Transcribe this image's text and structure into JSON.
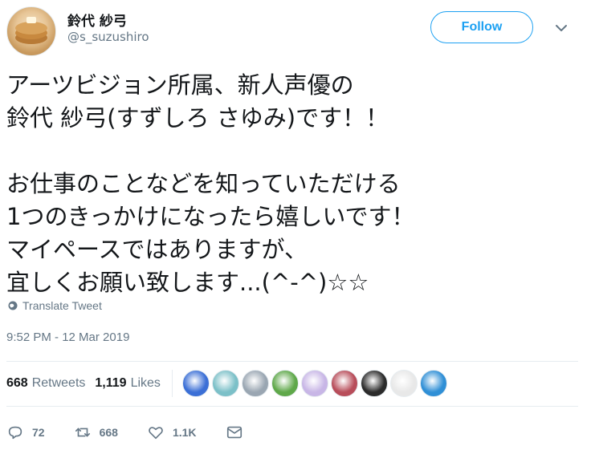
{
  "user": {
    "display_name": "鈴代 紗弓",
    "handle": "@s_suzushiro",
    "follow_label": "Follow"
  },
  "tweet": {
    "text": "アーツビジョン所属、新人声優の\n鈴代 紗弓(すずしろ さゆみ)です！！\n\nお仕事のことなどを知っていただける\n1つのきっかけになったら嬉しいです！\nマイペースではありますが、\n宜しくお願い致します...(^-^)☆☆",
    "translate_label": "Translate Tweet",
    "timestamp": "9:52 PM - 12 Mar 2019"
  },
  "stats": {
    "retweets_count": "668",
    "retweets_label": "Retweets",
    "likes_count": "1,119",
    "likes_label": "Likes"
  },
  "likers": [
    {
      "color": "#3b6fd6"
    },
    {
      "color": "#7cc0c8"
    },
    {
      "color": "#9aa6b2"
    },
    {
      "color": "#5fa84a"
    },
    {
      "color": "#c8b6e6"
    },
    {
      "color": "#b84d5a"
    },
    {
      "color": "#2b2b2b"
    },
    {
      "color": "#e8e8e8"
    },
    {
      "color": "#2f8fd6"
    }
  ],
  "actions": {
    "reply_count": "72",
    "retweet_count": "668",
    "like_count": "1.1K"
  },
  "colors": {
    "accent": "#1da1f2",
    "secondary_text": "#657786",
    "primary_text": "#14171a",
    "divider": "#e6ecf0"
  }
}
